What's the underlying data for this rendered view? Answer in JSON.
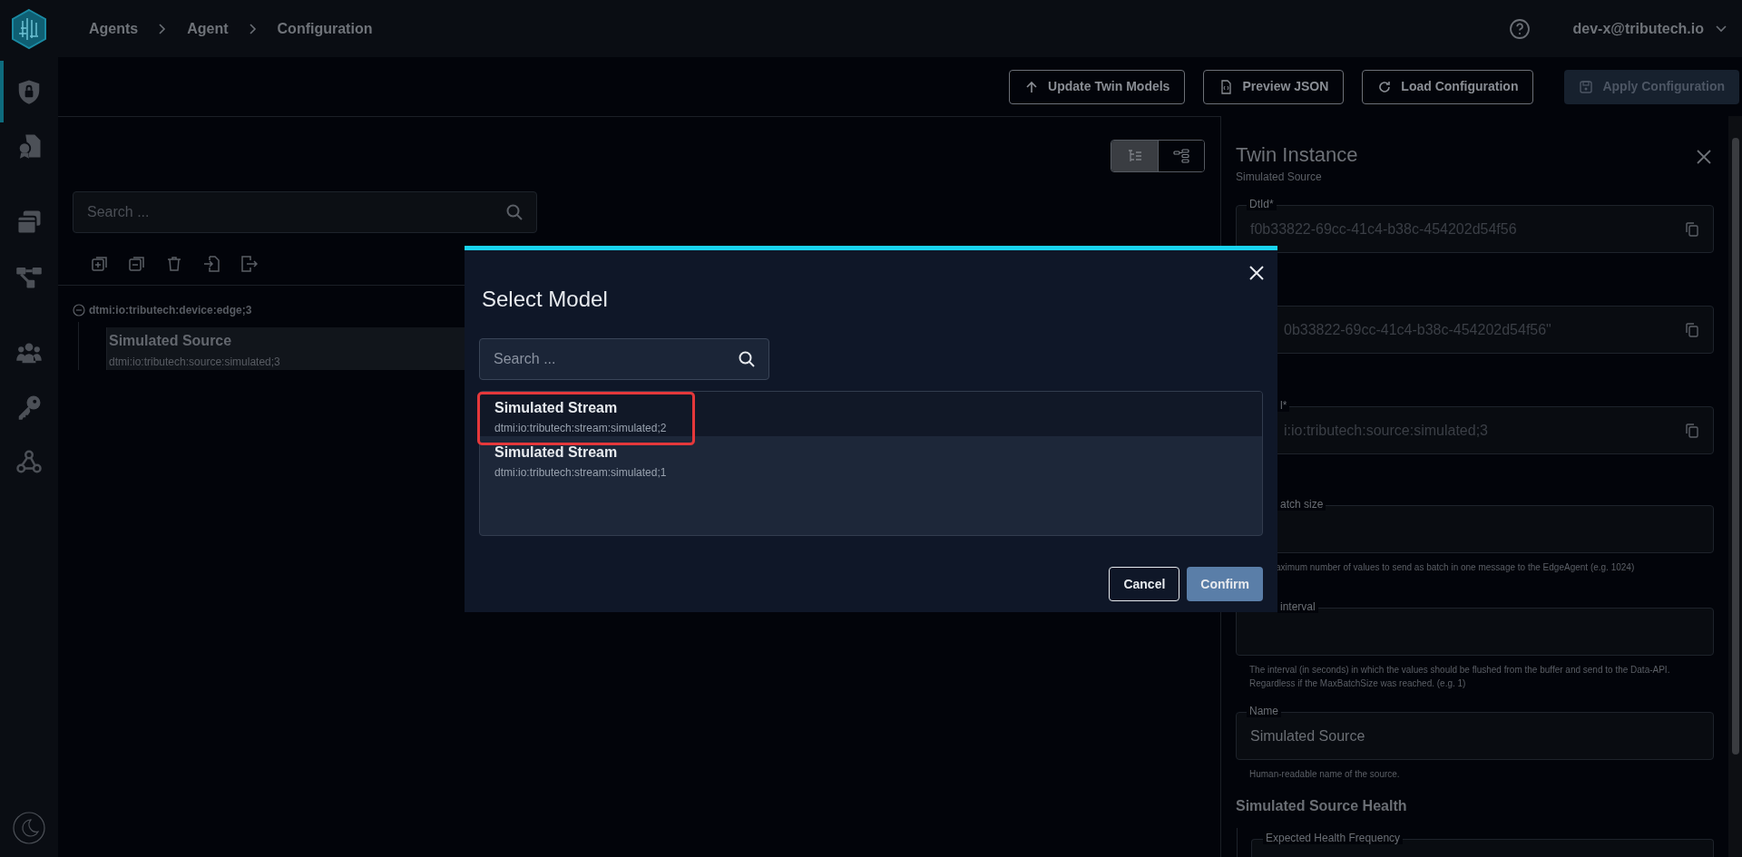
{
  "header": {
    "breadcrumbs": [
      "Agents",
      "Agent",
      "Configuration"
    ],
    "user": "dev-x@tributech.io"
  },
  "sidebar": {
    "items": [
      {
        "kind": "shield",
        "selected": true
      },
      {
        "kind": "certificate",
        "selected": false
      },
      {
        "kind": "cards",
        "selected": false
      },
      {
        "kind": "hierarchy",
        "selected": false
      },
      {
        "kind": "users",
        "selected": false
      },
      {
        "kind": "key",
        "selected": false
      },
      {
        "kind": "webhook",
        "selected": false
      }
    ]
  },
  "toolbar": {
    "buttons": [
      {
        "label": "Update Twin Models",
        "kind": "upload",
        "disabled": false
      },
      {
        "label": "Preview JSON",
        "kind": "file",
        "disabled": false
      },
      {
        "label": "Load Configuration",
        "kind": "reload",
        "disabled": false
      },
      {
        "label": "Apply Configuration",
        "kind": "save",
        "disabled": true
      }
    ]
  },
  "view_toggle": [
    {
      "kind": "tree",
      "selected": true
    },
    {
      "kind": "diagram",
      "selected": false
    }
  ],
  "search": {
    "placeholder": "Search ..."
  },
  "tree": {
    "label": "dtmi:io:tributech:device:edge;3",
    "expanded": true,
    "children": [
      {
        "title": "Simulated Source",
        "subtitle": "dtmi:io:tributech:source:simulated;3",
        "selected": true
      }
    ]
  },
  "panel": {
    "title": "Twin Instance",
    "subtitle": "Simulated Source",
    "fields": [
      {
        "label": "DtId*",
        "value": "f0b33822-69cc-41c4-b38c-454202d54f56",
        "copy": true
      },
      {
        "value": "0b33822-69cc-41c4-b38c-454202d54f56\"",
        "copy": true
      },
      {
        "label": "l*",
        "value": "i:io:tributech:source:simulated;3",
        "copy": true
      },
      {
        "label": "atch size",
        "helper": "aximum number of values to send as batch in one message to the EdgeAgent (e.g. 1024)",
        "copy": false
      },
      {
        "label": "interval",
        "helper": "The interval (in seconds) in which the values should be flushed from the buffer and send to the Data-API. Regardless if the MaxBatchSize was reached. (e.g. 1)",
        "copy": false
      },
      {
        "label": "Name",
        "value": "Simulated Source",
        "helper": "Human-readable name of the source.",
        "copy": false
      }
    ],
    "section_heading": "Simulated Source Health",
    "section_fields": [
      {
        "label": "Expected Health Frequency"
      }
    ]
  },
  "dialog": {
    "title": "Select Model",
    "search_placeholder": "Search ...",
    "models": [
      {
        "title": "Simulated Stream",
        "subtitle": "dtmi:io:tributech:stream:simulated;2",
        "selected": true,
        "marked": true
      },
      {
        "title": "Simulated Stream",
        "subtitle": "dtmi:io:tributech:stream:simulated;1",
        "selected": false,
        "marked": false
      }
    ],
    "buttons": [
      {
        "label": "Cancel",
        "kind": "secondary"
      },
      {
        "label": "Confirm",
        "kind": "primary"
      }
    ]
  }
}
